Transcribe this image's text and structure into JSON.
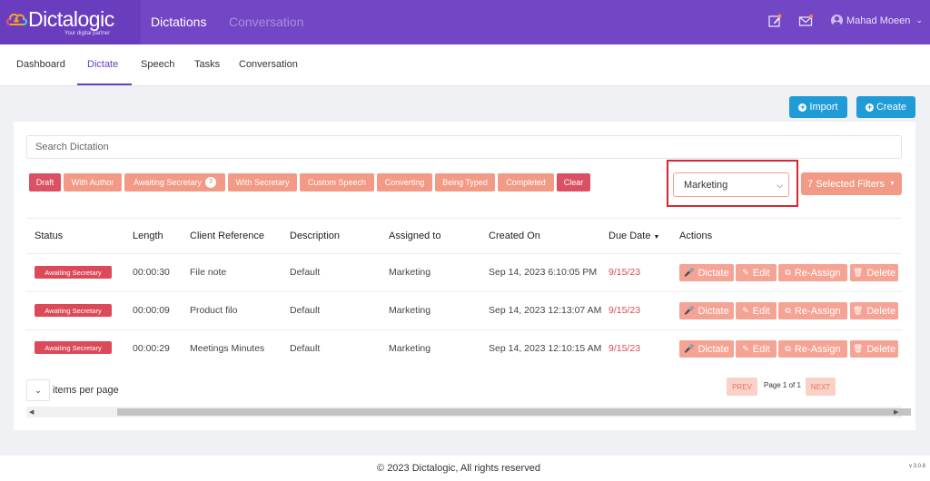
{
  "app": {
    "logo_text": "Dictalogic",
    "tagline": "Your digital partner"
  },
  "top_nav": [
    {
      "label": "Dictations"
    },
    {
      "label": "Conversation"
    }
  ],
  "user": {
    "name": "Mahad Moeen"
  },
  "sub_nav": [
    {
      "label": "Dashboard"
    },
    {
      "label": "Dictate"
    },
    {
      "label": "Speech"
    },
    {
      "label": "Tasks"
    },
    {
      "label": "Conversation"
    }
  ],
  "actions": {
    "import_label": "Import",
    "create_label": "Create"
  },
  "search": {
    "placeholder": "Search Dictation"
  },
  "status_chips": [
    {
      "label": "Draft"
    },
    {
      "label": "With Author"
    },
    {
      "label": "Awaiting Secretary",
      "count": "3"
    },
    {
      "label": "With Secretary"
    },
    {
      "label": "Custom Speech"
    },
    {
      "label": "Converting"
    },
    {
      "label": "Being Typed"
    },
    {
      "label": "Completed"
    },
    {
      "label": "Clear"
    }
  ],
  "department_select": {
    "value": "Marketing"
  },
  "filters_button": {
    "label": "7 Selected Filters"
  },
  "table": {
    "headers": [
      "Status",
      "Length",
      "Client Reference",
      "Description",
      "Assigned to",
      "Created On",
      "Due Date",
      "Actions"
    ],
    "rows": [
      {
        "status": "Awaiting Secretary",
        "length": "00:00:30",
        "client_reference": "File note",
        "description": "Default",
        "assigned_to": "Marketing",
        "created_on": "Sep 14, 2023 6:10:05 PM",
        "due_date": "9/15/23"
      },
      {
        "status": "Awaiting Secretary",
        "length": "00:00:09",
        "client_reference": "Product filo",
        "description": "Default",
        "assigned_to": "Marketing",
        "created_on": "Sep 14, 2023 12:13:07 AM",
        "due_date": "9/15/23"
      },
      {
        "status": "Awaiting Secretary",
        "length": "00:00:29",
        "client_reference": "Meetings Minutes",
        "description": "Default",
        "assigned_to": "Marketing",
        "created_on": "Sep 14, 2023 12:10:15 AM",
        "due_date": "9/15/23"
      }
    ],
    "row_actions": {
      "dictate": "Dictate",
      "edit": "Edit",
      "reassign": "Re-Assign",
      "delete": "Delete"
    }
  },
  "pagination": {
    "items_per_page_label": "items per page",
    "prev": "PREV",
    "info": "Page 1 of 1",
    "next": "NEXT"
  },
  "footer": {
    "copyright": "© 2023 Dictalogic, All rights reserved",
    "version": "v 3.0.8"
  },
  "colors": {
    "primary": "#7346c6",
    "accent_blue": "#1f9bd8",
    "chip_salmon": "#f29a85",
    "chip_red": "#dc5064",
    "highlight": "#d7262e"
  }
}
